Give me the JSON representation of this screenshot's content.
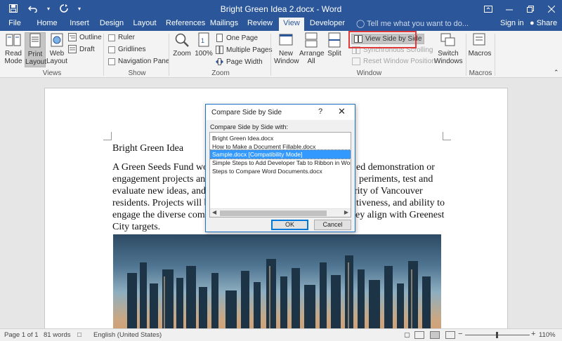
{
  "window": {
    "title": "Bright Green Idea 2.docx - Word",
    "minimize_icon": "minimize-icon",
    "restore_icon": "restore-icon",
    "close_icon": "close-icon"
  },
  "quick_access": {
    "save_icon": "save-icon",
    "undo_icon": "undo-icon",
    "redo_icon": "redo-icon",
    "customize_icon": "chevron-down-icon"
  },
  "tabs": [
    {
      "label": "File"
    },
    {
      "label": "Home"
    },
    {
      "label": "Insert"
    },
    {
      "label": "Design"
    },
    {
      "label": "Layout"
    },
    {
      "label": "References"
    },
    {
      "label": "Mailings"
    },
    {
      "label": "Review"
    },
    {
      "label": "View"
    },
    {
      "label": "Developer"
    }
  ],
  "tell_me": "Tell me what you want to do...",
  "sign_in": "Sign in",
  "share": "Share",
  "ribbon": {
    "views": {
      "label": "Views",
      "read_mode": "Read\nMode",
      "print_layout": "Print\nLayout",
      "web_layout": "Web\nLayout",
      "outline": "Outline",
      "draft": "Draft"
    },
    "show": {
      "label": "Show",
      "ruler": "Ruler",
      "gridlines": "Gridlines",
      "navigation_pane": "Navigation Pane"
    },
    "zoom": {
      "label": "Zoom",
      "zoom": "Zoom",
      "hundred": "100%",
      "one_page": "One Page",
      "multiple_pages": "Multiple Pages",
      "page_width": "Page Width"
    },
    "window": {
      "label": "Window",
      "new_window": "New\nWindow",
      "arrange_all": "Arrange\nAll",
      "split": "Split",
      "view_side_by_side": "View Side by Side",
      "synchronous_scrolling": "Synchronous Scrolling",
      "reset_window_position": "Reset Window Position",
      "switch_windows": "Switch\nWindows"
    },
    "macros": {
      "label": "Macros",
      "macros": "Macros"
    }
  },
  "document": {
    "heading": "Bright Green Idea",
    "lines": [
      "A Green Seeds Fund wou",
      "engagement projects annu",
      "evaluate new ideas, and ta",
      "residents. Projects will be",
      "engage the diverse commi",
      "City targets."
    ],
    "lines_right": [
      "ed demonstration or",
      "periments, test and",
      "rity of Vancouver",
      "tiveness, and ability to",
      "ey align with Greenest",
      ""
    ]
  },
  "dialog": {
    "title": "Compare Side by Side",
    "help": "?",
    "close": "✕",
    "prompt": "Compare Side by Side with:",
    "items": [
      "Bright Green Idea.docx",
      "How to Make a Document Fillable.docx",
      "Sample.docx [Compatibility Mode]",
      "Simple Steps to Add Developer Tab to Ribbon in Word.docx",
      "Steps to Compare Word Documents.docx"
    ],
    "selected_index": 2,
    "ok": "OK",
    "cancel": "Cancel"
  },
  "status": {
    "page": "Page 1 of 1",
    "words": "81 words",
    "language": "English (United States)",
    "zoom": "110%"
  }
}
